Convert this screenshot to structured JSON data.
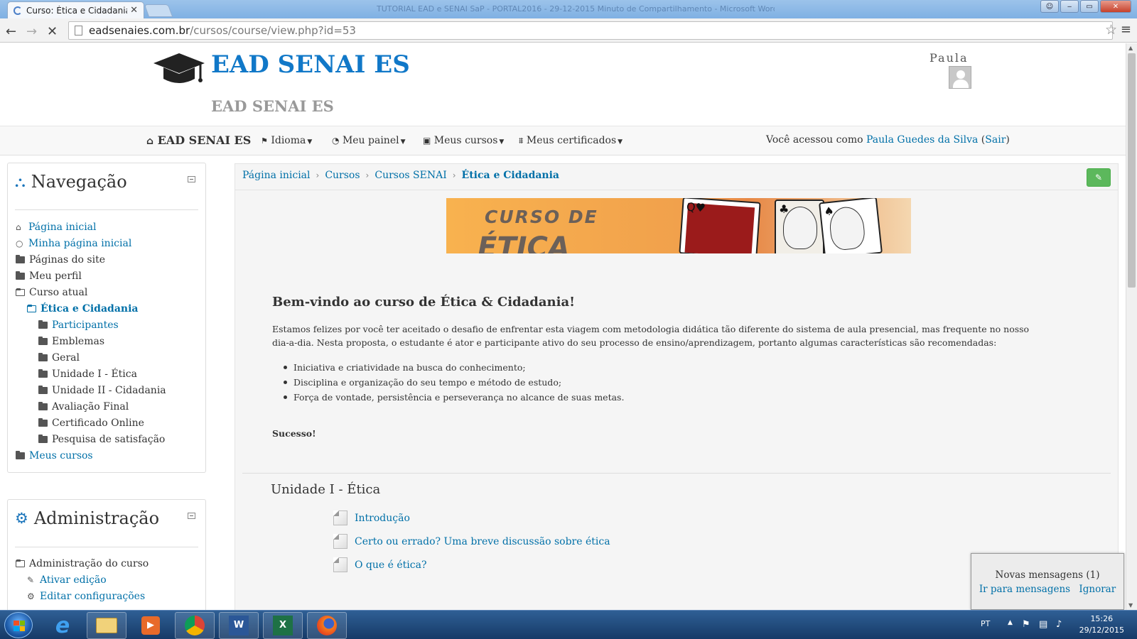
{
  "browser": {
    "tab_title": "Curso: Ética e Cidadania",
    "tab_close": "✕",
    "window_title": "TUTORIAL EAD e SENAI SaP - PORTAL2016 - 29-12-2015 Minuto de Compartilhamento - Microsoft Word",
    "url_host": "eadsenaies.com.br",
    "url_path": "/cursos/course/view.php?id=53",
    "back_icon": "arrow-left",
    "forward_icon": "arrow-right",
    "reload_icon": "stop-loading"
  },
  "header": {
    "logo_text": "EAD SENAI ES",
    "sub_title": "EAD SENAI ES",
    "user_short": "Paula"
  },
  "navbar": {
    "brand": "EAD SENAI ES",
    "items": [
      {
        "label": "Idioma",
        "icon": "flag-icon"
      },
      {
        "label": "Meu painel",
        "icon": "dashboard-icon"
      },
      {
        "label": "Meus cursos",
        "icon": "briefcase-icon"
      },
      {
        "label": "Meus certificados",
        "icon": "institution-icon"
      }
    ],
    "logged_in_prefix": "Você acessou como",
    "user_full": "Paula Guedes da Silva",
    "logout": "Sair"
  },
  "navigation_block": {
    "title": "Navegação",
    "items": [
      {
        "label": "Página inicial"
      },
      {
        "label": "Minha página inicial"
      },
      {
        "label": "Páginas do site"
      },
      {
        "label": "Meu perfil"
      },
      {
        "label": "Curso atual"
      },
      {
        "label": "Ética e Cidadania"
      },
      {
        "label": "Participantes"
      },
      {
        "label": "Emblemas"
      },
      {
        "label": "Geral"
      },
      {
        "label": "Unidade I - Ética"
      },
      {
        "label": "Unidade II - Cidadania"
      },
      {
        "label": "Avaliação Final"
      },
      {
        "label": "Certificado Online"
      },
      {
        "label": "Pesquisa de satisfação"
      },
      {
        "label": "Meus cursos"
      }
    ]
  },
  "admin_block": {
    "title": "Administração",
    "items": [
      {
        "label": "Administração do curso"
      },
      {
        "label": "Ativar edição"
      },
      {
        "label": "Editar configurações"
      }
    ]
  },
  "breadcrumb": [
    "Página inicial",
    "Cursos",
    "Cursos SENAI",
    "Ética e Cidadania"
  ],
  "banner": {
    "line1": "CURSO DE",
    "line2": "ÉTICA"
  },
  "course": {
    "welcome": "Bem-vindo ao curso de Ética & Cidadania!",
    "intro": "Estamos felizes por você ter aceitado o desafio de enfrentar esta viagem com metodologia didática tão diferente do sistema de aula presencial, mas frequente no nosso dia-a-dia. Nesta proposta, o estudante é ator e participante ativo do seu processo de ensino/aprendizagem, portanto algumas características são recomendadas:",
    "bullets": [
      "Iniciativa e criatividade na busca do conhecimento;",
      "Disciplina e organização do seu tempo e método de estudo;",
      "Força de vontade, persistência e perseverança no alcance de suas metas."
    ],
    "closing": "Sucesso!",
    "section_title": "Unidade I - Ética",
    "activities": [
      "Introdução",
      "Certo ou errado? Uma breve discussão sobre ética",
      "O que é ética?"
    ]
  },
  "messages_popup": {
    "title": "Novas mensagens (1)",
    "go": "Ir para mensagens",
    "ignore": "Ignorar"
  },
  "taskbar": {
    "lang": "PT",
    "time": "15:26",
    "date": "29/12/2015"
  }
}
